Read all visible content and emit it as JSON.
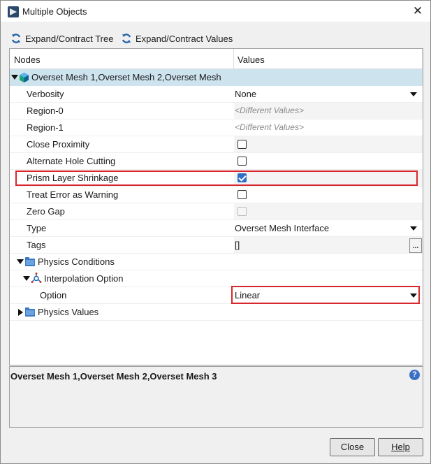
{
  "window": {
    "title": "Multiple Objects"
  },
  "toolbar": {
    "expand_tree": "Expand/Contract Tree",
    "expand_values": "Expand/Contract Values"
  },
  "columns": {
    "nodes": "Nodes",
    "values": "Values"
  },
  "root": {
    "label": "Overset Mesh 1,Overset Mesh 2,Overset Mesh"
  },
  "props": {
    "verbosity": {
      "label": "Verbosity",
      "value": "None"
    },
    "region0": {
      "label": "Region-0",
      "value": "<Different Values>"
    },
    "region1": {
      "label": "Region-1",
      "value": "<Different Values>"
    },
    "close_proximity": {
      "label": "Close Proximity",
      "checked": false
    },
    "alt_hole": {
      "label": "Alternate Hole Cutting",
      "checked": false
    },
    "prism": {
      "label": "Prism Layer Shrinkage",
      "checked": true
    },
    "treat_error": {
      "label": "Treat Error as Warning",
      "checked": false
    },
    "zero_gap": {
      "label": "Zero Gap",
      "checked": false,
      "disabled": true
    },
    "type": {
      "label": "Type",
      "value": "Overset Mesh Interface"
    },
    "tags": {
      "label": "Tags",
      "value": "[]",
      "button": "..."
    }
  },
  "physics_conditions": {
    "label": "Physics Conditions"
  },
  "interpolation": {
    "label": "Interpolation Option"
  },
  "option": {
    "label": "Option",
    "value": "Linear"
  },
  "physics_values": {
    "label": "Physics Values"
  },
  "description": {
    "text": "Overset Mesh 1,Overset Mesh 2,Overset Mesh 3",
    "help": "?"
  },
  "buttons": {
    "close": "Close",
    "help": "Help"
  },
  "colors": {
    "selection": "#cde3ee",
    "highlight_box": "#d9262c",
    "checkbox_on": "#2f6ec7"
  }
}
